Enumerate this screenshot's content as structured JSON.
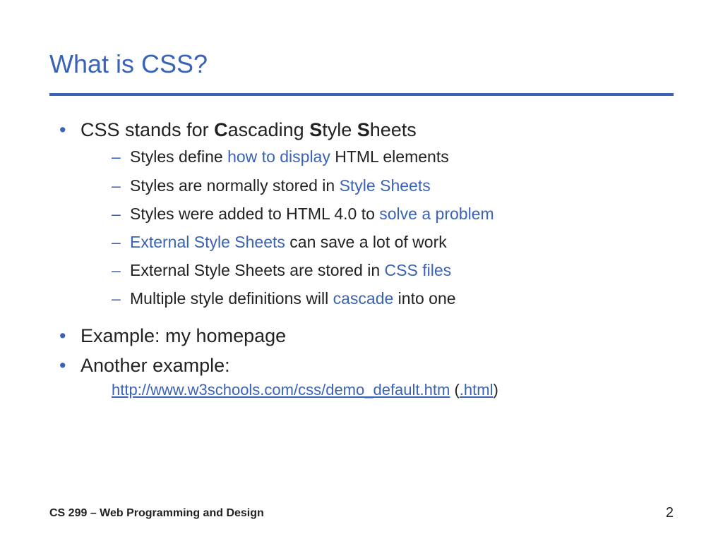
{
  "title": "What is CSS?",
  "bullets": {
    "b1": {
      "pre": "CSS stands for ",
      "c": "C",
      "c_rest": "ascading ",
      "s": "S",
      "s_rest": "tyle ",
      "sh": "S",
      "sh_rest": "heets"
    },
    "sub": {
      "s1_a": "Styles define ",
      "s1_b": "how to display",
      "s1_c": " HTML elements",
      "s2_a": "Styles are normally stored in ",
      "s2_b": "Style Sheets",
      "s3_a": "Styles were added to HTML 4.0 to ",
      "s3_b": "solve a problem",
      "s4_a": "External Style Sheets",
      "s4_b": " can save a lot of work",
      "s5_a": "External Style Sheets are stored in ",
      "s5_b": "CSS files",
      "s6_a": "Multiple style definitions will ",
      "s6_b": "cascade",
      "s6_c": " into one"
    },
    "b2": "Example: my homepage",
    "b3": "Another example:",
    "b3_url": "http://www.w3schools.com/css/demo_default.htm",
    "b3_open": " (",
    "b3_link2": ".html",
    "b3_close": ")"
  },
  "footer": {
    "course": "CS 299 – Web Programming and Design",
    "page": "2"
  }
}
